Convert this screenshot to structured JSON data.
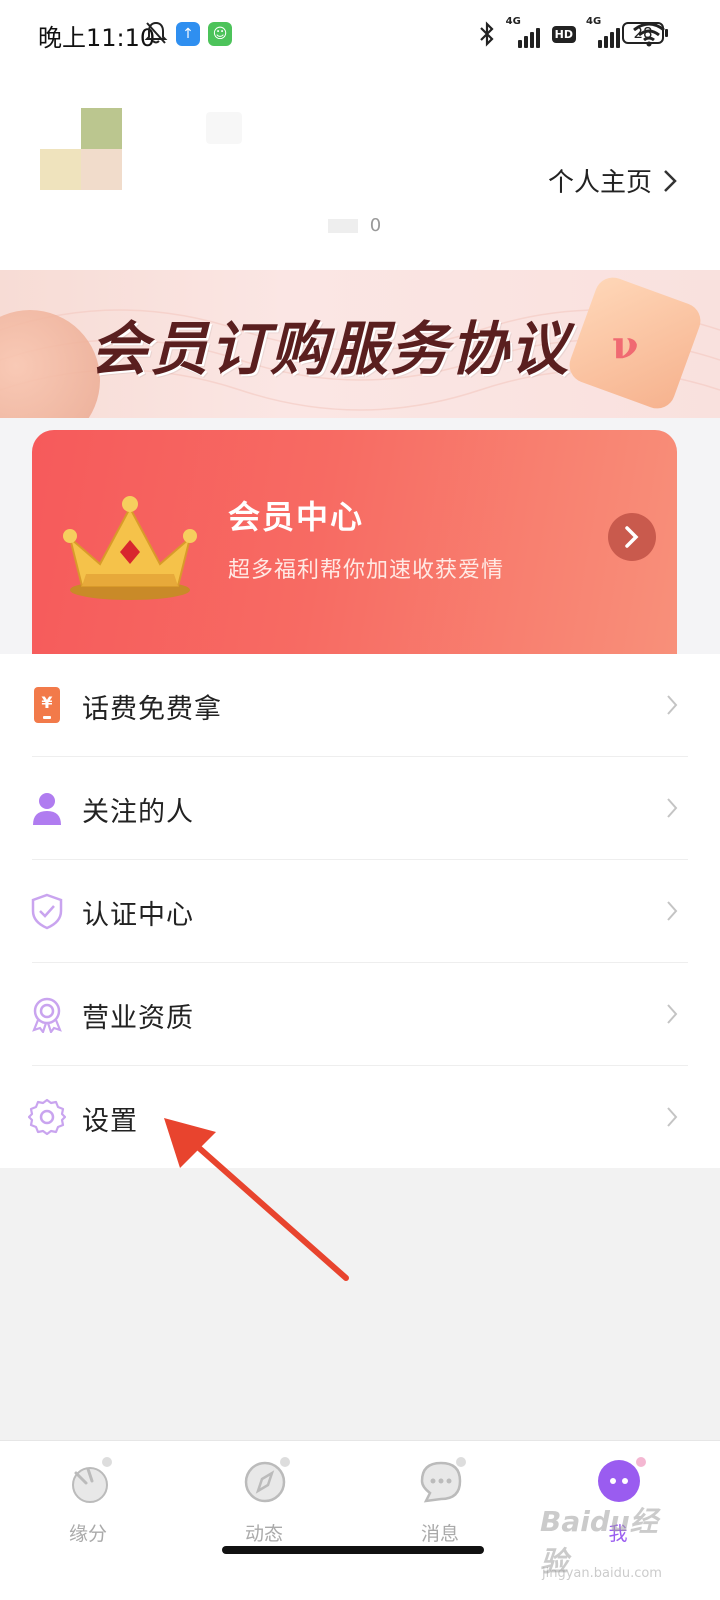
{
  "status_bar": {
    "time": "晚上11:10",
    "signal1_label": "4G",
    "signal2_label": "4G",
    "hd_label": "HD",
    "battery": "28"
  },
  "profile": {
    "home_link": "个人主页",
    "fans_count": "0"
  },
  "banner": {
    "title": "会员订购服务协议"
  },
  "vip": {
    "title": "会员中心",
    "subtitle": "超多福利帮你加速收获爱情"
  },
  "menu": {
    "items": [
      {
        "label": "话费免费拿",
        "icon": "phone-bill-icon"
      },
      {
        "label": "关注的人",
        "icon": "person-icon"
      },
      {
        "label": "认证中心",
        "icon": "shield-check-icon"
      },
      {
        "label": "营业资质",
        "icon": "badge-icon"
      },
      {
        "label": "设置",
        "icon": "gear-icon"
      }
    ]
  },
  "bottom_nav": {
    "items": [
      {
        "label": "缘分",
        "icon": "hand-heart-icon"
      },
      {
        "label": "动态",
        "icon": "compass-icon"
      },
      {
        "label": "消息",
        "icon": "chat-bubble-icon"
      },
      {
        "label": "我",
        "icon": "profile-bubble-icon"
      }
    ],
    "active_index": 3
  },
  "watermark": {
    "main": "Baidu经验",
    "sub": "jingyan.baidu.com"
  },
  "colors": {
    "accent_purple": "#9a5cf0",
    "vip_red": "#f65a5b",
    "annotation_red": "#e8442e"
  }
}
